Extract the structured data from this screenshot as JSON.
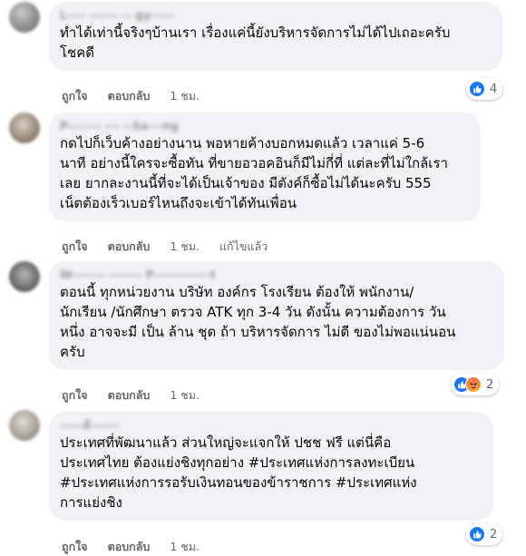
{
  "comments": [
    {
      "author": "L---- ------ -- gy-----",
      "text": "ทำได้เท่านี้จริงๆบ้านเรา เรื่องแค่นี้ยังบริหารจัดการไม่ได้ไปเถอะครับ\nโชคดี",
      "like": "ถูกใจ",
      "reply": "ตอบกลับ",
      "time": "1 ชม.",
      "edited": "",
      "reaction_count": "4",
      "reactions": [
        "like-icon"
      ]
    },
    {
      "author": "P------- --- --Sa---ng",
      "text": "กดไปก็เว็บค้างอย่างนาน พอหายค้างบอกหมดแล้ว เวลาแค่ 5-6\nนาที อย่างนี้ใครจะซื้อทัน ที่ขายอวอคอินก็มีไม่กี่ที่ แต่ละที่ไม่ใกล้เรา\nเลย ยากละงานนี้ที่จะได้เป็นเจ้าของ มีตังค์ก็ซื้อไม่ได้นะครับ 555\nเน็ตต้องเร็วเบอร์ไหนถึงจะเข้าได้ทันเพื่อน",
      "like": "ถูกใจ",
      "reply": "ตอบกลับ",
      "time": "1 ชม.",
      "edited": "แก้ไขแล้ว",
      "reaction_count": "",
      "reactions": []
    },
    {
      "author": "W------- ------- P------------t",
      "text": "ตอนนี้ ทุกหน่วยงาน บริษัท องค์กร โรงเรียน ต้องให้ พนักงาน/\nนักเรียน /นักศึกษา ตรวจ ATK ทุก 3-4 วัน ดังนั้น ความต้องการ วัน\nหนึ่ง อาจจะมี เป็น ล้าน ชุด ถ้า บริหารจัดการ ไม่ดี ของไม่พอแน่นอน\nครับ",
      "like": "ถูกใจ",
      "reply": "ตอบกลับ",
      "time": "1 ชม.",
      "edited": "",
      "reaction_count": "2",
      "reactions": [
        "like-icon",
        "angry-icon"
      ]
    },
    {
      "author": "-----ด้------",
      "text": "ประเทศที่พัฒนาแล้ว ส่วนใหญ่จะแจกให้ ปชช ฟรี แต่นี่คือ\nประเทศไทย ต้องแย่งชิงทุกอย่าง #ประเทศแห่งการลงทะเบียน\n#ประเทศแห่งการรอรับเงินทอนของข้าราชการ #ประเทศแห่ง\nการแย่งชิง",
      "like": "ถูกใจ",
      "reply": "ตอบกลับ",
      "time": "1 ชม.",
      "edited": "",
      "reaction_count": "2",
      "reactions": [
        "like-icon"
      ]
    }
  ]
}
